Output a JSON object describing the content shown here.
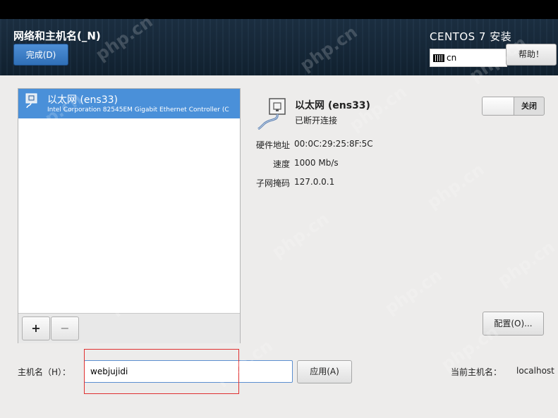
{
  "header": {
    "title": "网络和主机名(_N)",
    "done_label": "完成(D)",
    "product": "CENTOS 7 安装",
    "keyboard_layout": "cn",
    "help_label": "帮助！"
  },
  "connections": {
    "items": [
      {
        "name": "以太网 (ens33)",
        "description": "Intel Corporation 82545EM Gigabit Ethernet Controller (C"
      }
    ],
    "add_label": "+",
    "remove_label": "−"
  },
  "detail": {
    "name": "以太网 (ens33)",
    "status": "已断开连接",
    "switch_label": "关闭",
    "properties": [
      {
        "label": "硬件地址",
        "value": "00:0C:29:25:8F:5C"
      },
      {
        "label": "速度",
        "value": "1000 Mb/s"
      },
      {
        "label": "子网掩码",
        "value": "127.0.0.1"
      }
    ],
    "config_label": "配置(O)..."
  },
  "hostname": {
    "label": "主机名（H）：",
    "value": "webjujidi",
    "apply_label": "应用(A)",
    "current_label": "当前主机名：",
    "current_value": "localhost"
  },
  "watermark": "php.cn",
  "colors": {
    "accent": "#4a90d9",
    "header_bg": "#152636",
    "highlight": "#e03030"
  }
}
